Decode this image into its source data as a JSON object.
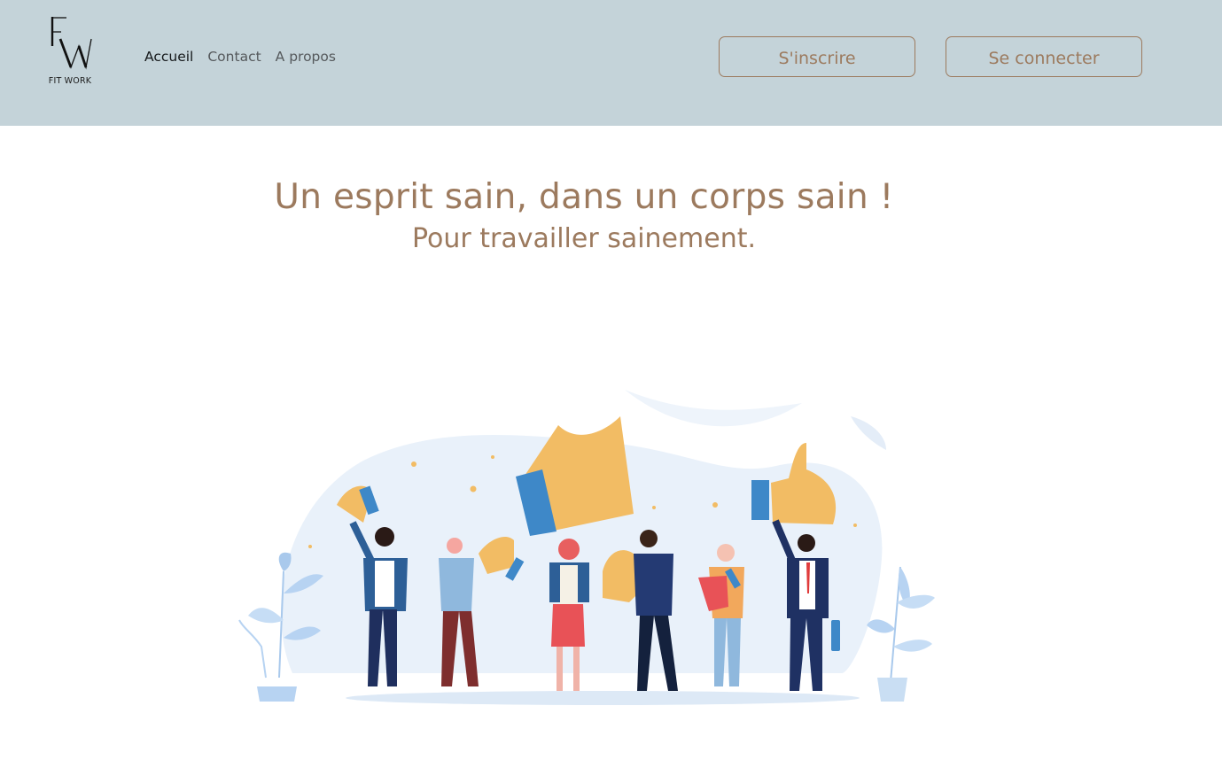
{
  "brand": {
    "monogram": "FW",
    "name": "FIT WORK"
  },
  "nav": {
    "items": [
      {
        "label": "Accueil"
      },
      {
        "label": "Contact"
      },
      {
        "label": "A propos"
      }
    ]
  },
  "auth": {
    "signup_label": "S'inscrire",
    "login_label": "Se connecter"
  },
  "hero": {
    "title": "Un esprit sain, dans un corps sain !",
    "subtitle": "Pour travailler sainement."
  },
  "illustration": {
    "icon": "thumbs-up-team-illustration"
  },
  "colors": {
    "header_bg": "#c4d3d9",
    "accent": "#9c7a5e",
    "thumb": "#f2bc64",
    "blue": "#3e88c8"
  }
}
